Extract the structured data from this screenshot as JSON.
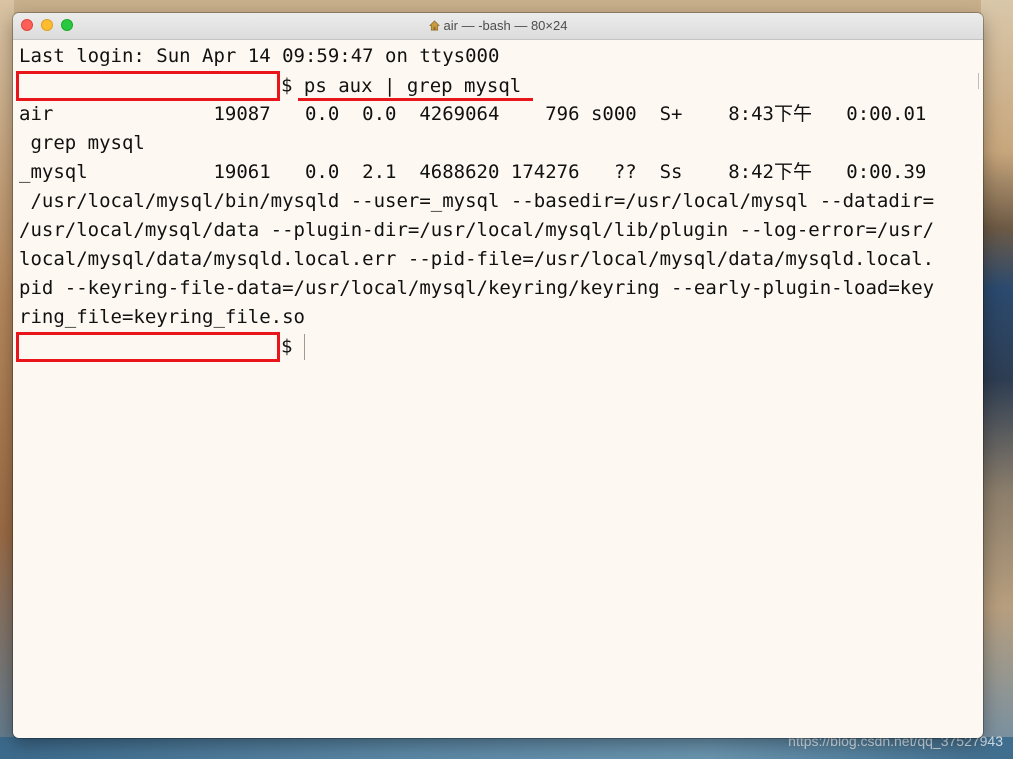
{
  "window": {
    "title": "air — -bash — 80×24",
    "title_icon": "home-icon"
  },
  "terminal": {
    "lines": [
      "Last login: Sun Apr 14 09:59:47 on ttys000",
      "air              19087   0.0  0.0  4269064    796 s000  S+    8:43下午   0:00.01",
      " grep mysql",
      "_mysql           19061   0.0  2.1  4688620 174276   ??  Ss    8:42下午   0:00.39",
      " /usr/local/mysql/bin/mysqld --user=_mysql --basedir=/usr/local/mysql --datadir=",
      "/usr/local/mysql/data --plugin-dir=/usr/local/mysql/lib/plugin --log-error=/usr/",
      "local/mysql/data/mysqld.local.err --pid-file=/usr/local/mysql/data/mysqld.local.",
      "pid --keyring-file-data=/usr/local/mysql/keyring/keyring --early-plugin-load=key",
      "ring_file=keyring_file.so"
    ],
    "prompt_symbol": "$",
    "command": "ps aux | grep mysql"
  },
  "watermark": "https://blog.csdn.net/qq_37527943",
  "colors": {
    "annotation_red": "#e8151b",
    "terminal_bg": "#fdf9f2",
    "text": "#111111"
  }
}
